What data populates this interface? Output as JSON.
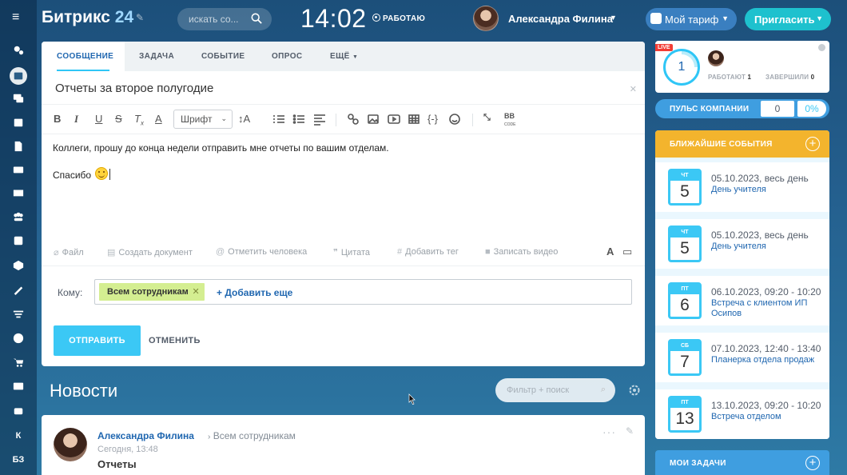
{
  "header": {
    "logo_text": "Битрикс",
    "logo_num": "24",
    "search_placeholder": "искать со...",
    "clock": "14:02",
    "work_status": "РАБОТАЮ",
    "user_name": "Александра Филина",
    "plan_label": "Мой тариф",
    "invite_label": "Пригласить"
  },
  "sidebar": {
    "items": [
      "activity-icon",
      "feed-icon",
      "chat-icon",
      "calendar-icon",
      "docs-icon",
      "drive-icon",
      "mail-icon",
      "groups-icon",
      "tasks-icon",
      "crm-icon",
      "sign-icon",
      "filter-icon",
      "target-icon",
      "shop-icon",
      "sites-icon",
      "robot-icon"
    ],
    "k_label": "К",
    "kb_label": "БЗ"
  },
  "composer": {
    "tabs": {
      "message": "СООБЩЕНИЕ",
      "task": "ЗАДАЧА",
      "event": "СОБЫТИЕ",
      "poll": "ОПРОС",
      "more": "ЕЩЁ"
    },
    "title": "Отчеты за второе полугодие",
    "toolbar": {
      "bold": "B",
      "italic": "I",
      "underline": "U",
      "strike": "S",
      "font": "Шрифт"
    },
    "body_line1": "Коллеги, прошу до конца недели отправить мне отчеты по вашим отделам.",
    "body_line2": "Спасибо",
    "attach": {
      "file": "Файл",
      "create_doc": "Создать документ",
      "mention": "Отметить человека",
      "quote": "Цитата",
      "tag": "Добавить тег",
      "video": "Записать видео"
    },
    "to_label": "Кому:",
    "recipient": "Всем сотрудникам",
    "add_more": "+ Добавить еще",
    "send": "ОТПРАВИТЬ",
    "cancel": "ОТМЕНИТЬ"
  },
  "news": {
    "title": "Новости",
    "filter_placeholder": "Фильтр + поиск"
  },
  "post": {
    "author": "Александра Филина",
    "destination": "Всем сотрудникам",
    "time": "Сегодня, 13:48",
    "heading": "Отчеты"
  },
  "live": {
    "badge": "LIVE",
    "count": "1",
    "working_label": "РАБОТАЮТ",
    "working_count": "1",
    "finished_label": "ЗАВЕРШИЛИ",
    "finished_count": "0"
  },
  "pulse": {
    "label": "ПУЛЬС КОМПАНИИ",
    "value": "0",
    "percent": "0%"
  },
  "events": {
    "title": "БЛИЖАЙШИЕ СОБЫТИЯ",
    "items": [
      {
        "dow": "ЧТ",
        "day": "5",
        "time": "05.10.2023, весь день",
        "name": "День учителя"
      },
      {
        "dow": "ЧТ",
        "day": "5",
        "time": "05.10.2023, весь день",
        "name": "День учителя"
      },
      {
        "dow": "ПТ",
        "day": "6",
        "time": "06.10.2023, 09:20 - 10:20",
        "name": "Встреча с клиентом ИП Осипов"
      },
      {
        "dow": "СБ",
        "day": "7",
        "time": "07.10.2023, 12:40 - 13:40",
        "name": "Планерка отдела продаж"
      },
      {
        "dow": "ПТ",
        "day": "13",
        "time": "13.10.2023, 09:20 - 10:20",
        "name": "Встреча отделом"
      }
    ]
  },
  "tasks": {
    "title": "МОИ ЗАДАЧИ"
  }
}
